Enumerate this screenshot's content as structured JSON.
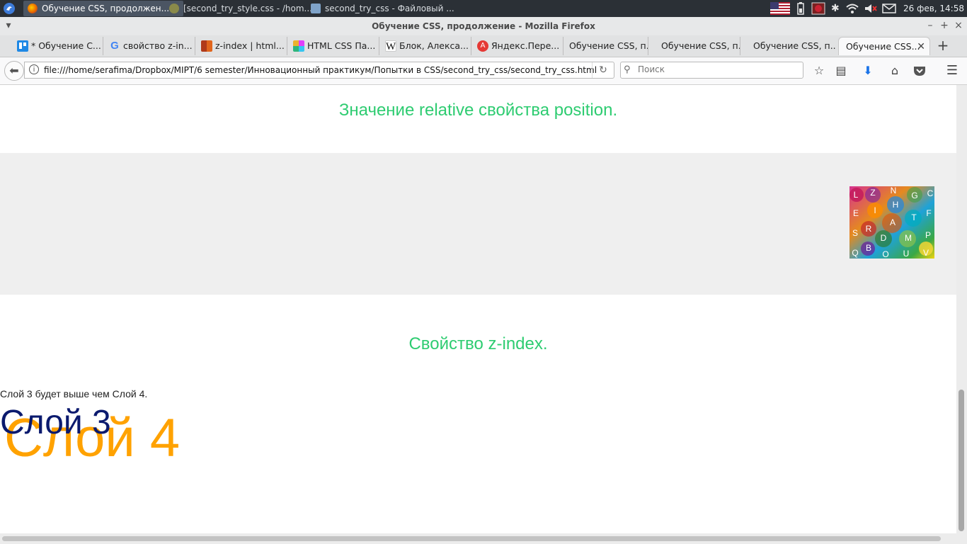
{
  "taskbar": {
    "tasks": [
      {
        "label": "Обучение CSS, продолжен..."
      },
      {
        "label": "[second_try_style.css - /hom..."
      },
      {
        "label": "second_try_css - Файловый ..."
      }
    ],
    "clock": "26 фев, 14:58"
  },
  "window": {
    "title": "Обучение CSS, продолжение - Mozilla Firefox"
  },
  "tabs": [
    {
      "label": "* Обучение С...",
      "color": "#1e88e5"
    },
    {
      "label": "свойство z-in...",
      "color": "#4285f4"
    },
    {
      "label": "z-index | html...",
      "color": "#b03a1a"
    },
    {
      "label": "HTML CSS Па...",
      "color": "#e040fb"
    },
    {
      "label": "Блок, Алекса...",
      "color": "#333333"
    },
    {
      "label": "Яндекс.Пере...",
      "color": "#e53935"
    },
    {
      "label": "Обучение CSS, п..."
    },
    {
      "label": "Обучение CSS, п..."
    },
    {
      "label": "Обучение CSS, п..."
    },
    {
      "label": "Обучение CSS..."
    }
  ],
  "navbar": {
    "url": "file:///home/serafima/Dropbox/MIPT/6 semester/Инновационный практикум/Попытки в CSS/second_try_css/second_try_css.html",
    "search_placeholder": "Поиск"
  },
  "page": {
    "heading_relative": "Значение relative свойства position.",
    "heading_zindex": "Свойство z-index.",
    "note": "Слой 3 будет выше чем Слой 4.",
    "layer3": "Слой 3",
    "layer4": "Слой 4",
    "image_letters": [
      "L",
      "Z",
      "N",
      "G",
      "C",
      "I",
      "H",
      "E",
      "T",
      "F",
      "R",
      "A",
      "S",
      "D",
      "M",
      "P",
      "B",
      "Q",
      "O",
      "U",
      "V"
    ],
    "colors": {
      "heading": "#2ecc71",
      "layer3": "#0b1a6e",
      "layer4": "#ffa200",
      "gray_box": "#efefef"
    }
  }
}
